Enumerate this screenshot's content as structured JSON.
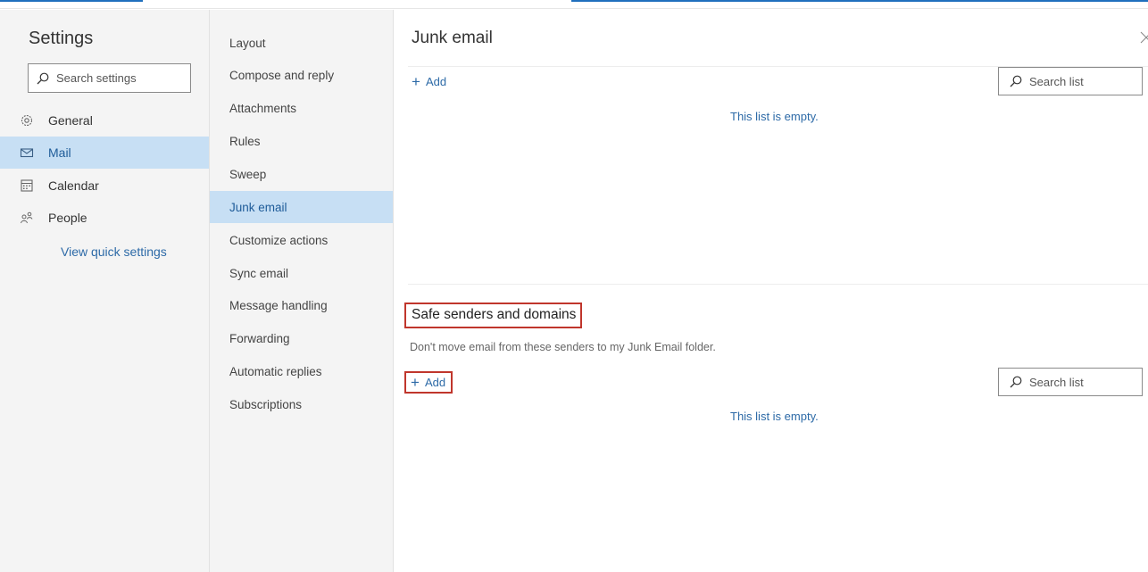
{
  "settings": {
    "title": "Settings",
    "search_placeholder": "Search settings"
  },
  "nav": {
    "items": [
      {
        "label": "General",
        "icon": "gear-icon"
      },
      {
        "label": "Mail",
        "icon": "mail-icon"
      },
      {
        "label": "Calendar",
        "icon": "calendar-icon"
      },
      {
        "label": "People",
        "icon": "people-icon"
      }
    ],
    "selected": "Mail",
    "view_quick_settings": "View quick settings"
  },
  "mail_menu": {
    "items": [
      "Layout",
      "Compose and reply",
      "Attachments",
      "Rules",
      "Sweep",
      "Junk email",
      "Customize actions",
      "Sync email",
      "Message handling",
      "Forwarding",
      "Automatic replies",
      "Subscriptions"
    ],
    "selected": "Junk email"
  },
  "content": {
    "title": "Junk email",
    "blocked": {
      "add_label": "Add",
      "search_placeholder": "Search list",
      "empty_text": "This list is empty."
    },
    "safe_senders": {
      "title": "Safe senders and domains",
      "description": "Don't move email from these senders to my Junk Email folder.",
      "add_label": "Add",
      "search_placeholder": "Search list",
      "empty_text": "This list is empty."
    }
  },
  "colors": {
    "accent": "#2d6aa7",
    "selected_bg": "#c7dff4",
    "highlight_box": "#c0362c"
  }
}
